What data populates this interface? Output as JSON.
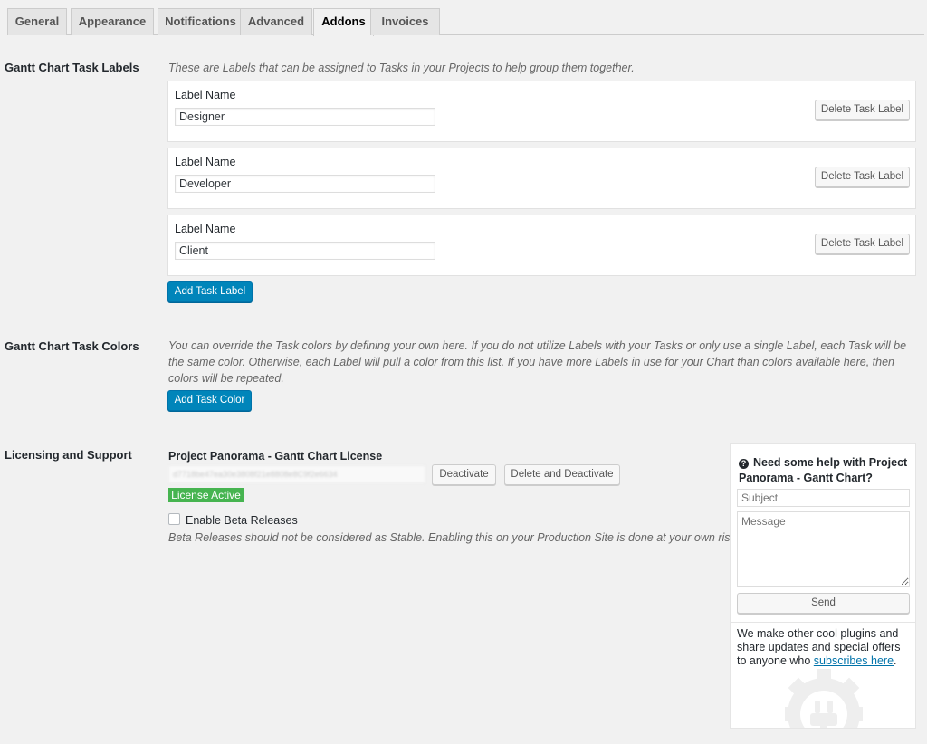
{
  "tabs": [
    {
      "label": "General",
      "active": false
    },
    {
      "label": "Appearance",
      "active": false
    },
    {
      "label": "Notifications",
      "active": false
    },
    {
      "label": "Advanced",
      "active": false
    },
    {
      "label": "Addons",
      "active": true
    },
    {
      "label": "Invoices",
      "active": false
    }
  ],
  "task_labels": {
    "title": "Gantt Chart Task Labels",
    "description": "These are Labels that can be assigned to Tasks in your Projects to help group them together.",
    "field_label": "Label Name",
    "delete_label": "Delete Task Label",
    "items": [
      {
        "value": "Designer"
      },
      {
        "value": "Developer"
      },
      {
        "value": "Client"
      }
    ],
    "add_label": "Add Task Label"
  },
  "task_colors": {
    "title": "Gantt Chart Task Colors",
    "description": "You can override the Task colors by defining your own here. If you do not utilize Labels with your Tasks or only use a single Label, each Task will be the same color. Otherwise, each Label will pull a color from this list. If you have more Labels in use for your Chart than colors available here, then colors will be repeated.",
    "add_label": "Add Task Color"
  },
  "licensing": {
    "title": "Licensing and Support",
    "license_title": "Project Panorama - Gantt Chart License",
    "license_key": "d7718be47ea30e3808f21e8808e8C9f2e6634",
    "deactivate_label": "Deactivate",
    "delete_deactivate_label": "Delete and Deactivate",
    "status": "License Active",
    "beta_label": "Enable Beta Releases",
    "beta_description": "Beta Releases should not be considered as Stable. Enabling this on your Production Site is done at your own risk."
  },
  "help": {
    "title": "Need some help with Project Panorama - Gantt Chart?",
    "subject_placeholder": "Subject",
    "message_placeholder": "Message",
    "send_label": "Send",
    "promo_before": "We make other cool plugins and share updates and special offers to anyone who ",
    "promo_link": "subscribes here",
    "promo_after": "."
  },
  "colors": {
    "primary": "#0085ba",
    "active_badge": "#46b450"
  },
  "icons": {
    "help": "question-circle-icon",
    "logo": "gear-plug-icon"
  }
}
